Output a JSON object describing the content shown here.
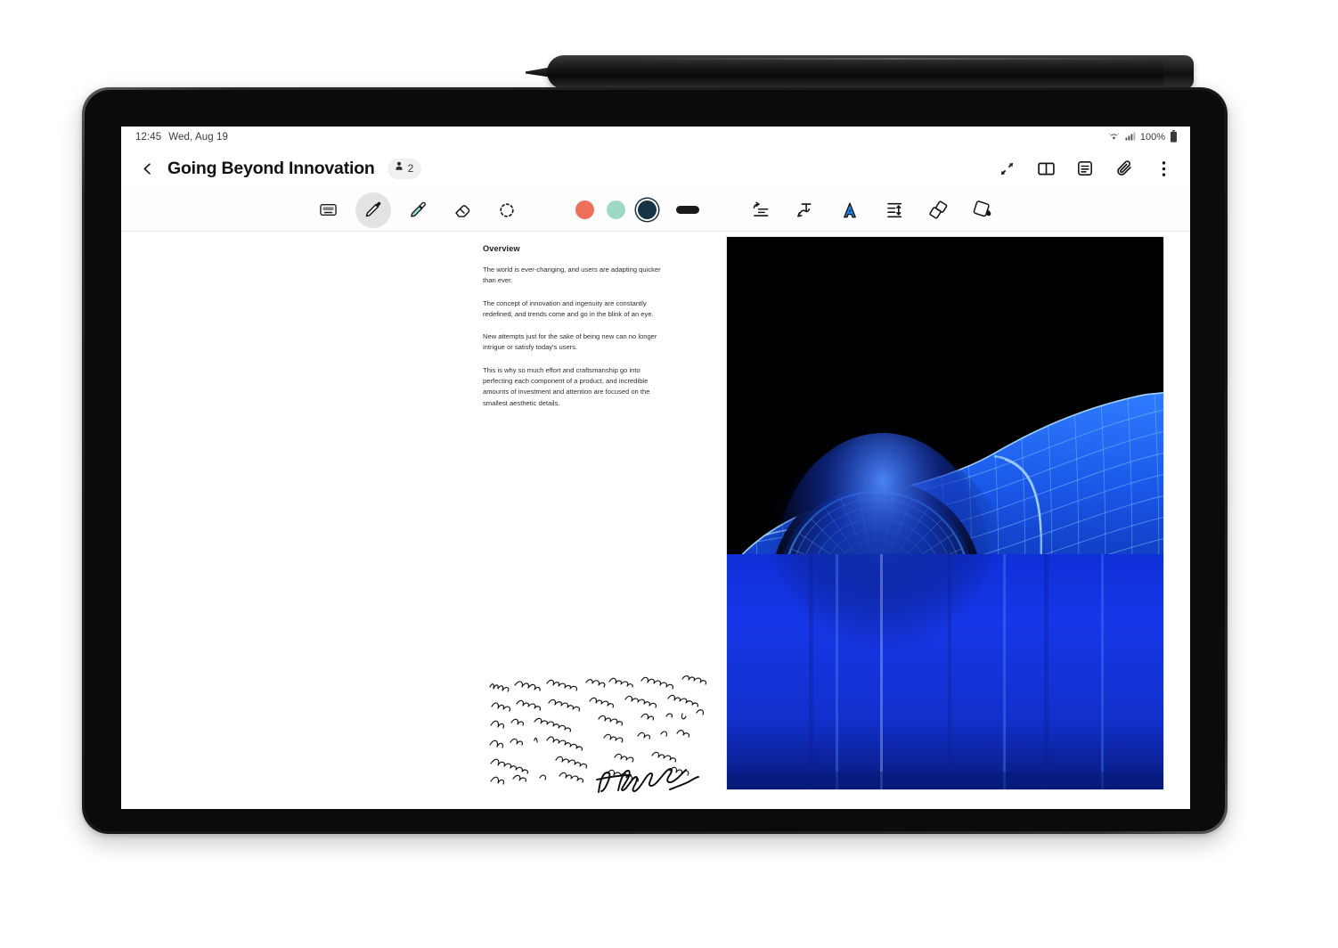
{
  "device": {
    "name": "tablet",
    "stylus": "s-pen",
    "frame_color": "#1a1a1c"
  },
  "status_bar": {
    "time": "12:45",
    "date": "Wed, Aug 19",
    "battery_percent": "100%",
    "icons": [
      "wifi-icon",
      "signal-icon",
      "battery-icon"
    ]
  },
  "app_bar": {
    "back_label": "",
    "title": "Going Beyond Innovation",
    "collaborators_count": "2",
    "actions": [
      {
        "name": "expand-icon",
        "label": ""
      },
      {
        "name": "book-view-icon",
        "label": ""
      },
      {
        "name": "notes-list-icon",
        "label": ""
      },
      {
        "name": "attachment-icon",
        "label": ""
      },
      {
        "name": "more-options-icon",
        "label": ""
      }
    ]
  },
  "toolbar": {
    "tools_left": [
      {
        "name": "keyboard-tool",
        "label": "Keyboard",
        "active": false
      },
      {
        "name": "pen-tool",
        "label": "Pen",
        "active": true
      },
      {
        "name": "highlighter-tool",
        "label": "Highlighter",
        "active": false
      },
      {
        "name": "eraser-tool",
        "label": "Eraser",
        "active": false
      },
      {
        "name": "lasso-select-tool",
        "label": "Selection",
        "active": false
      }
    ],
    "colors": [
      {
        "name": "color-coral",
        "hex": "#ef6f5c",
        "selected": false
      },
      {
        "name": "color-mint",
        "hex": "#9ed8c6",
        "selected": false
      },
      {
        "name": "color-navy",
        "hex": "#173447",
        "selected": true
      }
    ],
    "thickness": {
      "name": "pen-thickness",
      "label": "",
      "hex": "#1a1a1a"
    },
    "tools_right": [
      {
        "name": "text-align-tool",
        "label": "Align text",
        "active": false
      },
      {
        "name": "straighten-text-tool",
        "label": "Straighten",
        "active": false
      },
      {
        "name": "convert-to-text-tool",
        "label": "A",
        "active": true,
        "hex": "#1a8cf0"
      },
      {
        "name": "line-spacing-tool",
        "label": "Line spacing",
        "active": false
      },
      {
        "name": "shape-convert-tool",
        "label": "Shapes",
        "active": false
      },
      {
        "name": "fill-tool",
        "label": "Fill",
        "active": false
      }
    ]
  },
  "note": {
    "heading": "Overview",
    "paragraphs": [
      "The world is ever-changing, and users are adapting quicker than ever.",
      "The concept of innovation and ingenuity are constantly redefined, and trends come and go in the blink of an eye.",
      "New attempts just for the sake of being new can no longer intrigue or satisfy today's users.",
      "This is why so much effort and craftsmanship go into perfecting each component of a product, and incredible amounts of investment and attention are focused on the smallest aesthetic details."
    ],
    "handwriting": {
      "name": "handwritten-cursive-note",
      "lines": 6,
      "has_signature": true,
      "ink_color": "#111111"
    },
    "image": {
      "name": "wireframe-sports-car-image",
      "caption": "",
      "background_hex": "#000000",
      "wireframe_hex": "#2b7dff",
      "glow_hex": "#7fd4ff",
      "reflection_hex": "#1433d8"
    }
  }
}
